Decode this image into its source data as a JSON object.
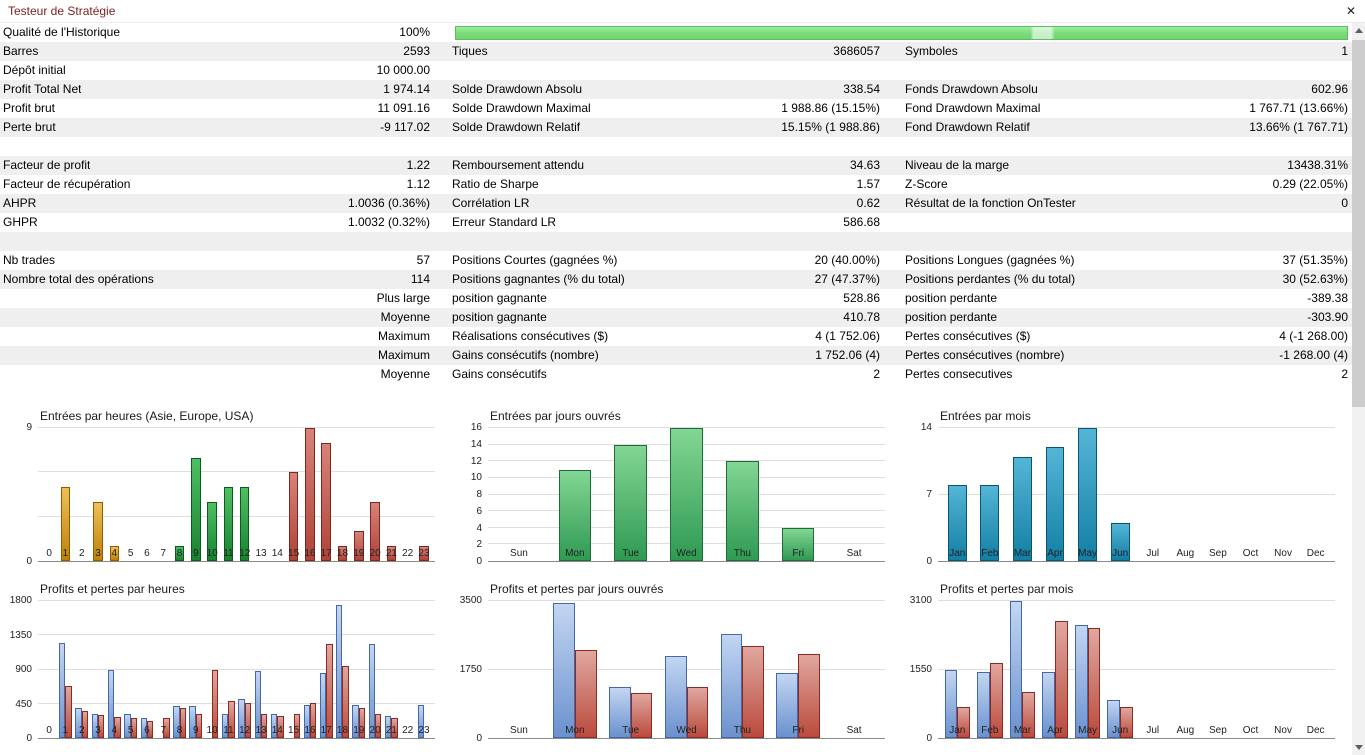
{
  "window": {
    "title": "Testeur de Stratégie",
    "close_glyph": "✕"
  },
  "colors": {
    "title_text": "#7a1f1f",
    "row_stripe": "#efefef",
    "progress_green": "#79db79",
    "axis_line": "#8a8a8a"
  },
  "stats": {
    "rows": [
      {
        "c1l": "Qualité de l'Historique",
        "c1v": "100%",
        "progress": true
      },
      {
        "c1l": "Barres",
        "c1v": "2593",
        "c2l": "Tiques",
        "c2v": "3686057",
        "c3l": "Symboles",
        "c3v": "1"
      },
      {
        "c1l": "Dépôt initial",
        "c1v": "10 000.00"
      },
      {
        "c1l": "Profit Total Net",
        "c1v": "1 974.14",
        "c2l": "Solde Drawdown Absolu",
        "c2v": "338.54",
        "c3l": "Fonds Drawdown Absolu",
        "c3v": "602.96"
      },
      {
        "c1l": "Profit brut",
        "c1v": "11 091.16",
        "c2l": "Solde Drawdown Maximal",
        "c2v": "1 988.86 (15.15%)",
        "c3l": "Fond Drawdown Maximal",
        "c3v": "1 767.71 (13.66%)"
      },
      {
        "c1l": "Perte brut",
        "c1v": "-9 117.02",
        "c2l": "Solde Drawdown Relatif",
        "c2v": "15.15% (1 988.86)",
        "c3l": "Fond Drawdown Relatif",
        "c3v": "13.66% (1 767.71)"
      },
      {},
      {
        "c1l": "Facteur de profit",
        "c1v": "1.22",
        "c2l": "Remboursement attendu",
        "c2v": "34.63",
        "c3l": "Niveau de la marge",
        "c3v": "13438.31%"
      },
      {
        "c1l": "Facteur de récupération",
        "c1v": "1.12",
        "c2l": "Ratio de Sharpe",
        "c2v": "1.57",
        "c3l": "Z-Score",
        "c3v": "0.29 (22.05%)"
      },
      {
        "c1l": "AHPR",
        "c1v": "1.0036 (0.36%)",
        "c2l": "Corrélation LR",
        "c2v": "0.62",
        "c3l": "Résultat de la fonction OnTester",
        "c3v": "0"
      },
      {
        "c1l": "GHPR",
        "c1v": "1.0032 (0.32%)",
        "c2l": "Erreur Standard LR",
        "c2v": "586.68"
      },
      {},
      {
        "c1l": "Nb trades",
        "c1v": "57",
        "c2l": "Positions Courtes (gagnées %)",
        "c2v": "20 (40.00%)",
        "c3l": "Positions Longues (gagnées %)",
        "c3v": "37 (51.35%)"
      },
      {
        "c1l": "Nombre total des opérations",
        "c1v": "114",
        "c2l": "Positions gagnantes (% du total)",
        "c2v": "27 (47.37%)",
        "c3l": "Positions perdantes (% du total)",
        "c3v": "30 (52.63%)"
      },
      {
        "c1v": "Plus large",
        "c2l": "position gagnante",
        "c2v": "528.86",
        "c3l": "position perdante",
        "c3v": "-389.38"
      },
      {
        "c1v": "Moyenne",
        "c2l": "position gagnante",
        "c2v": "410.78",
        "c3l": "position perdante",
        "c3v": "-303.90"
      },
      {
        "c1v": "Maximum",
        "c2l": "Réalisations consécutives ($)",
        "c2v": "4 (1 752.06)",
        "c3l": "Pertes consécutives ($)",
        "c3v": "4 (-1 268.00)"
      },
      {
        "c1v": "Maximum",
        "c2l": "Gains consécutifs (nombre)",
        "c2v": "1 752.06 (4)",
        "c3l": "Pertes consécutives (nombre)",
        "c3v": "-1 268.00 (4)"
      },
      {
        "c1v": "Moyenne",
        "c2l": "Gains consécutifs",
        "c2v": "2",
        "c3l": "Pertes consecutives",
        "c3v": "2"
      }
    ]
  },
  "palettes": {
    "asia": {
      "top": "#EFBE5A",
      "bottom": "#C08108",
      "border": "#8A5E00"
    },
    "europe": {
      "top": "#4FBF63",
      "bottom": "#17832F",
      "border": "#0E5A20"
    },
    "usa": {
      "top": "#D8837A",
      "bottom": "#AF4238",
      "border": "#7C261E"
    },
    "days": {
      "top": "#83D694",
      "bottom": "#2F9A52",
      "border": "#1E6B39"
    },
    "months": {
      "top": "#55B5D6",
      "bottom": "#137FA5",
      "border": "#0B566F"
    },
    "profit": {
      "top": "#C3D6F2",
      "bottom": "#6A91CE",
      "border": "#4468A8"
    },
    "loss": {
      "top": "#E0A79F",
      "bottom": "#BB4A3D",
      "border": "#8A2A20"
    }
  },
  "chart_data": [
    {
      "type": "bar",
      "title": "Entrées par heures (Asie, Europe, USA)",
      "categories": [
        "0",
        "1",
        "2",
        "3",
        "4",
        "5",
        "6",
        "7",
        "8",
        "9",
        "10",
        "11",
        "12",
        "13",
        "14",
        "15",
        "16",
        "17",
        "18",
        "19",
        "20",
        "21",
        "22",
        "23"
      ],
      "values": [
        0,
        5,
        0,
        4,
        1,
        0,
        0,
        0,
        1,
        7,
        4,
        5,
        5,
        0,
        0,
        6,
        9,
        8,
        1,
        2,
        4,
        1,
        0,
        1
      ],
      "bar_keys": [
        "asia",
        "asia",
        "asia",
        "asia",
        "asia",
        "asia",
        "asia",
        "asia",
        "europe",
        "europe",
        "europe",
        "europe",
        "europe",
        "europe",
        "europe",
        "usa",
        "usa",
        "usa",
        "usa",
        "usa",
        "usa",
        "usa",
        "usa",
        "usa"
      ],
      "xlabel": "",
      "ylabel": "",
      "ylim": [
        0,
        9
      ],
      "ytick_labels": [
        0,
        9
      ],
      "gridlines": [
        3,
        6,
        9
      ]
    },
    {
      "type": "bar",
      "title": "Entrées par jours ouvrés",
      "categories": [
        "Sun",
        "Mon",
        "Tue",
        "Wed",
        "Thu",
        "Fri",
        "Sat"
      ],
      "values": [
        0,
        11,
        14,
        16,
        12,
        4,
        0
      ],
      "palette": "days",
      "xlabel": "",
      "ylabel": "",
      "ylim": [
        0,
        16
      ],
      "ytick_labels": [
        0,
        2,
        4,
        6,
        8,
        10,
        12,
        14,
        16
      ],
      "gridlines": [
        2,
        4,
        6,
        8,
        10,
        12,
        14,
        16
      ]
    },
    {
      "type": "bar",
      "title": "Entrées par mois",
      "categories": [
        "Jan",
        "Feb",
        "Mar",
        "Apr",
        "May",
        "Jun",
        "Jul",
        "Aug",
        "Sep",
        "Oct",
        "Nov",
        "Dec"
      ],
      "values": [
        8,
        8,
        11,
        12,
        14,
        4,
        0,
        0,
        0,
        0,
        0,
        0
      ],
      "palette": "months",
      "xlabel": "",
      "ylabel": "",
      "ylim": [
        0,
        14
      ],
      "ytick_labels": [
        0,
        7,
        14
      ],
      "gridlines": [
        7,
        14
      ]
    },
    {
      "type": "bar",
      "title": "Profits et pertes par heures",
      "categories": [
        "0",
        "1",
        "2",
        "3",
        "4",
        "5",
        "6",
        "7",
        "8",
        "9",
        "10",
        "11",
        "12",
        "13",
        "14",
        "15",
        "16",
        "17",
        "18",
        "19",
        "20",
        "21",
        "22",
        "23"
      ],
      "series": [
        {
          "name": "profits",
          "palette": "profit",
          "values": [
            0,
            1250,
            400,
            310,
            900,
            310,
            260,
            0,
            420,
            420,
            0,
            320,
            510,
            880,
            320,
            0,
            430,
            860,
            1750,
            440,
            1230,
            290,
            0,
            430
          ]
        },
        {
          "name": "pertes",
          "palette": "loss",
          "values": [
            0,
            680,
            350,
            300,
            280,
            260,
            230,
            260,
            390,
            310,
            900,
            490,
            460,
            310,
            290,
            310,
            460,
            1230,
            950,
            400,
            310,
            260,
            0,
            0
          ]
        }
      ],
      "xlabel": "",
      "ylabel": "",
      "ylim": [
        0,
        1800
      ],
      "ytick_labels": [
        0,
        450,
        900,
        1350,
        1800
      ],
      "gridlines": [
        450,
        900,
        1350,
        1800
      ]
    },
    {
      "type": "bar",
      "title": "Profits et pertes par jours ouvrés",
      "categories": [
        "Sun",
        "Mon",
        "Tue",
        "Wed",
        "Thu",
        "Fri",
        "Sat"
      ],
      "series": [
        {
          "name": "profits",
          "palette": "profit",
          "values": [
            0,
            3450,
            1300,
            2100,
            2650,
            1650,
            0
          ]
        },
        {
          "name": "pertes",
          "palette": "loss",
          "values": [
            0,
            2250,
            1150,
            1300,
            2350,
            2150,
            0
          ]
        }
      ],
      "xlabel": "",
      "ylabel": "",
      "ylim": [
        0,
        3500
      ],
      "ytick_labels": [
        0,
        1750,
        3500
      ],
      "gridlines": [
        1750,
        3500
      ]
    },
    {
      "type": "bar",
      "title": "Profits et pertes par mois",
      "categories": [
        "Jan",
        "Feb",
        "Mar",
        "Apr",
        "May",
        "Jun",
        "Jul",
        "Aug",
        "Sep",
        "Oct",
        "Nov",
        "Dec"
      ],
      "series": [
        {
          "name": "profits",
          "palette": "profit",
          "values": [
            1550,
            1500,
            3100,
            1500,
            2550,
            850,
            0,
            0,
            0,
            0,
            0,
            0
          ]
        },
        {
          "name": "pertes",
          "palette": "loss",
          "values": [
            700,
            1700,
            1050,
            2650,
            2500,
            700,
            0,
            0,
            0,
            0,
            0,
            0
          ]
        }
      ],
      "xlabel": "",
      "ylabel": "",
      "ylim": [
        0,
        3100
      ],
      "ytick_labels": [
        0,
        1550,
        3100
      ],
      "gridlines": [
        1550,
        3100
      ]
    }
  ]
}
